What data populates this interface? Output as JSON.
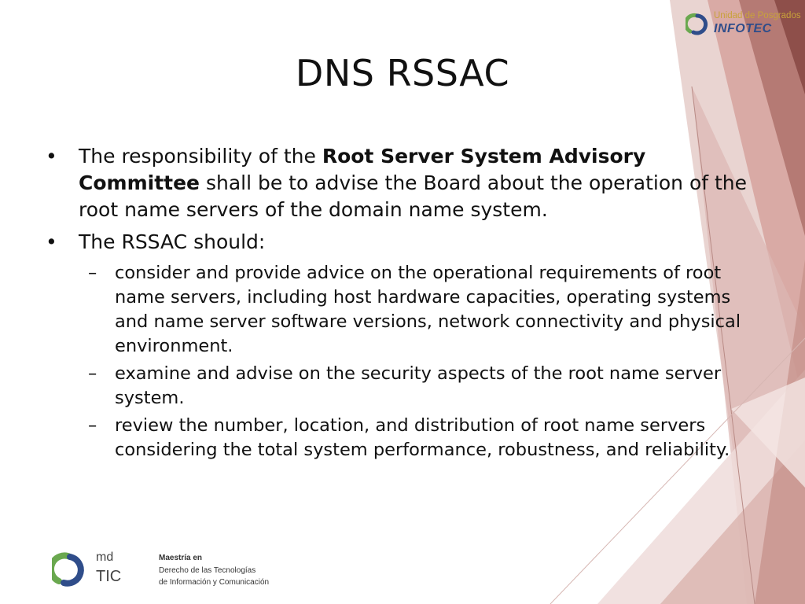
{
  "slide": {
    "title": "DNS RSSAC",
    "bullets": [
      {
        "prefix": "The responsibility of the ",
        "bold": "Root Server System Advisory Committee",
        "suffix": " shall be to advise the Board about the operation of the root name servers of the domain name system."
      },
      {
        "text": "The RSSAC should:",
        "subitems": [
          "consider and provide advice on the operational requirements of root name servers, including host hardware capacities, operating systems and name server software versions, network connectivity and physical environment.",
          "examine and advise on the security aspects of the root name server system.",
          "review the number, location, and distribution of root name servers considering the total system performance, robustness, and reliability."
        ]
      }
    ],
    "bullet_char": "•",
    "dash_char": "–"
  },
  "logos": {
    "top": {
      "unidad": "Unidad de Posgrados",
      "infotec": "INFOTEC"
    },
    "bottom": {
      "md": "md",
      "tic": "TIC",
      "maestria": "Maestría en",
      "line2": "Derecho de las Tecnologías",
      "line3": "de Información y Comunicación"
    }
  },
  "colors": {
    "deco_dark": "#a9655f",
    "deco_mid": "#c9918b",
    "deco_light": "#e6c9c5",
    "logo_green": "#6aa84f",
    "logo_blue": "#2f4d8a",
    "logo_gold": "#c8a23a"
  }
}
